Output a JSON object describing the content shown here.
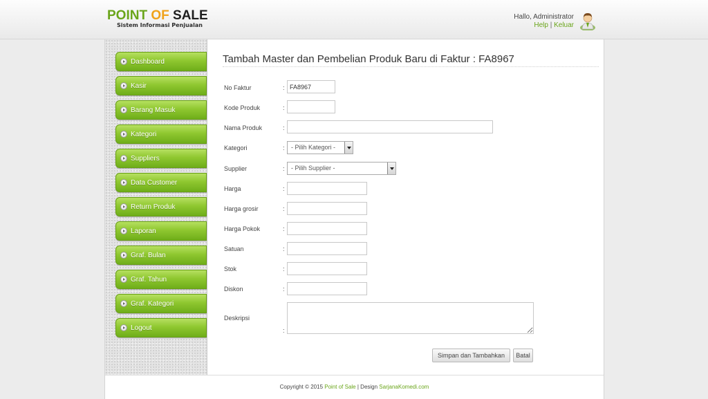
{
  "header": {
    "logo_word1": "POINT",
    "logo_word2": "OF",
    "logo_word3": "SALE",
    "subtitle": "Sistem Informasi Penjualan",
    "greeting": "Hallo, Administrator",
    "help_link": "Help",
    "separator": "|",
    "logout_link": "Keluar",
    "accent_color": "#6aa51a",
    "logo_orange": "#f0a21a",
    "avatar_icon": "user-avatar-icon"
  },
  "sidebar": {
    "items": [
      {
        "label": "Dashboard"
      },
      {
        "label": "Kasir"
      },
      {
        "label": "Barang Masuk"
      },
      {
        "label": "Kategori"
      },
      {
        "label": "Suppliers"
      },
      {
        "label": "Data Customer"
      },
      {
        "label": "Return Produk"
      },
      {
        "label": "Laporan"
      },
      {
        "label": "Graf. Bulan"
      },
      {
        "label": "Graf. Tahun"
      },
      {
        "label": "Graf. Kategori"
      },
      {
        "label": "Logout"
      }
    ],
    "item_color": "#8fc730"
  },
  "form": {
    "title": "Tambah Master dan Pembelian Produk Baru di Faktur : FA8967",
    "colon": ":",
    "no_faktur": {
      "label": "No Faktur",
      "value": "FA8967"
    },
    "kode_produk": {
      "label": "Kode Produk",
      "value": ""
    },
    "nama_produk": {
      "label": "Nama Produk",
      "value": ""
    },
    "kategori": {
      "label": "Kategori",
      "selected": "- Pilih Kategori -"
    },
    "supplier": {
      "label": "Supplier",
      "selected": "- Pilih Supplier -"
    },
    "harga": {
      "label": "Harga",
      "value": ""
    },
    "harga_grosir": {
      "label": "Harga grosir",
      "value": ""
    },
    "harga_pokok": {
      "label": "Harga Pokok",
      "value": ""
    },
    "satuan": {
      "label": "Satuan",
      "value": ""
    },
    "stok": {
      "label": "Stok",
      "value": ""
    },
    "diskon": {
      "label": "Diskon",
      "value": ""
    },
    "deskripsi": {
      "label": "Deskripsi",
      "value": ""
    },
    "save_button": "Simpan dan Tambahkan",
    "cancel_button": "Batal"
  },
  "footer": {
    "prefix": "Copyright © 2015",
    "app_link": "Point of Sale",
    "middle": "| Design",
    "designer_link": "SarjanaKomedi.com"
  }
}
